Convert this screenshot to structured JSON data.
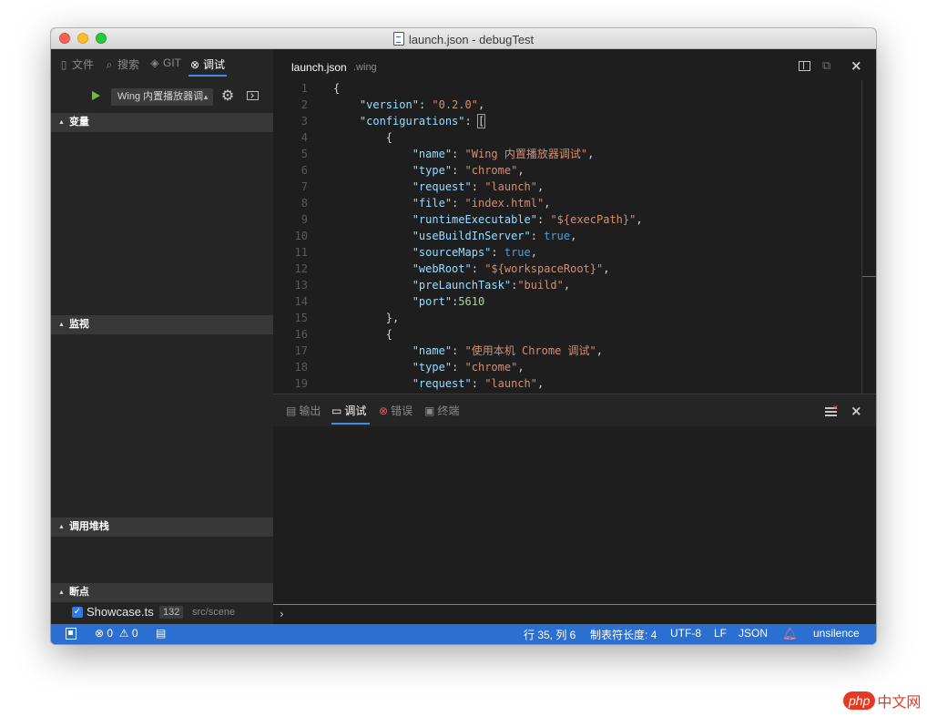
{
  "window": {
    "title": "launch.json - debugTest"
  },
  "sidebar": {
    "tabs": [
      {
        "icon": "file-icon",
        "label": "文件"
      },
      {
        "icon": "search-icon",
        "label": "搜索"
      },
      {
        "icon": "git-icon",
        "label": "GIT"
      },
      {
        "icon": "debug-icon",
        "label": "调试"
      }
    ],
    "active_tab": "调试",
    "debug_config": "Wing 内置播放器调",
    "sections": {
      "variables": "变量",
      "watch": "监视",
      "callstack": "调用堆栈",
      "breakpoints": "断点"
    },
    "breakpoint": {
      "file": "Showcase.ts",
      "line": "132",
      "path": "src/scene"
    }
  },
  "editor": {
    "tab_name": "launch.json",
    "tab_dir": ".wing",
    "line_numbers": [
      "1",
      "2",
      "3",
      "4",
      "5",
      "6",
      "7",
      "8",
      "9",
      "10",
      "11",
      "12",
      "13",
      "14",
      "15",
      "16",
      "17",
      "18",
      "19"
    ],
    "code": {
      "version_val": "\"0.2.0\"",
      "name1_val": "\"Wing 内置播放器调试\"",
      "type1_val": "\"chrome\"",
      "request1_val": "\"launch\"",
      "file_val": "\"index.html\"",
      "runtime_val": "\"${execPath}\"",
      "usebuild_val": "true",
      "sourcemaps_val": "true",
      "webroot_val": "\"${workspaceRoot}\"",
      "prelaunch_val": "\"build\"",
      "port_val": "5610",
      "name2_val": "\"使用本机 Chrome 调试\"",
      "type2_val": "\"chrome\"",
      "request2_val": "\"launch\""
    }
  },
  "panel": {
    "tabs": [
      {
        "icon": "output-icon",
        "label": "输出"
      },
      {
        "icon": "debug-console-icon",
        "label": "调试"
      },
      {
        "icon": "error-icon",
        "label": "错误"
      },
      {
        "icon": "terminal-icon",
        "label": "终端"
      }
    ],
    "active_tab": "调试",
    "prompt": "›"
  },
  "statusbar": {
    "errors": "0",
    "warnings": "0",
    "position": "行 35, 列 6",
    "tab_size": "制表符长度: 4",
    "encoding": "UTF-8",
    "eol": "LF",
    "language": "JSON",
    "user": "unsilence"
  },
  "watermark": {
    "php": "php",
    "cn": "中文网"
  },
  "colors": {
    "statusbar": "#2b6fd1",
    "accent": "#3d8ee6",
    "keys": "#9cdcfe",
    "strings": "#ce9178",
    "numbers": "#b5cea8",
    "booleans": "#569cd6"
  }
}
